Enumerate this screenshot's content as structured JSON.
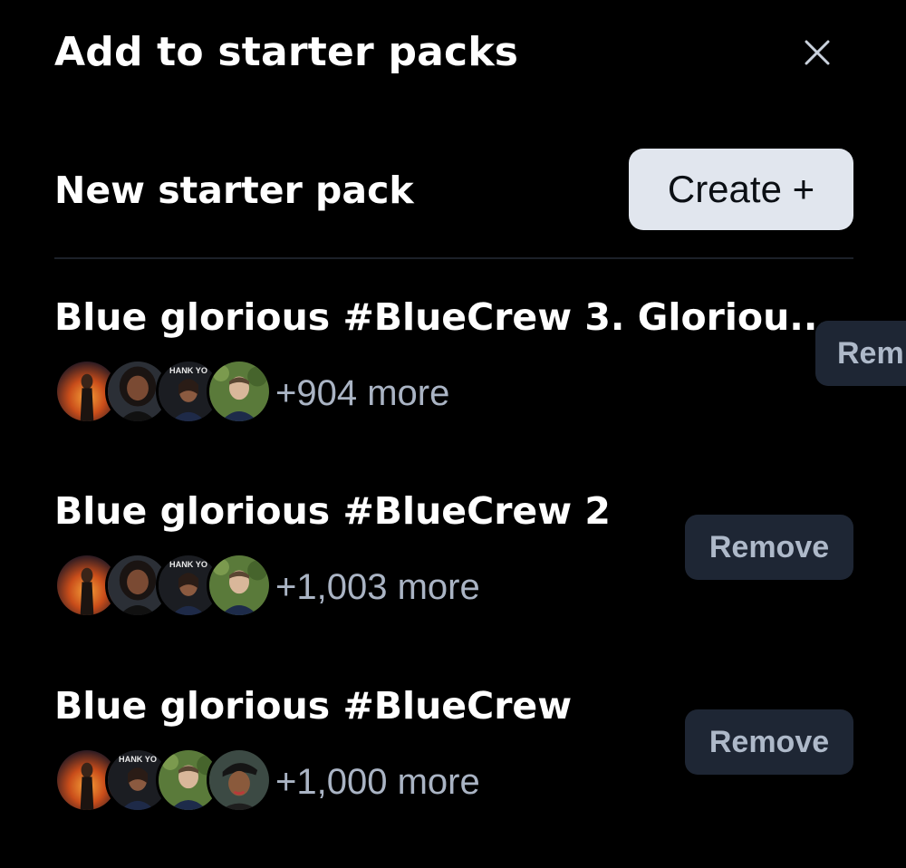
{
  "dialog": {
    "title": "Add to starter packs",
    "close_icon": "close-icon"
  },
  "new_pack": {
    "label": "New starter pack",
    "create_label": "Create +"
  },
  "packs": [
    {
      "name": "Blue glorious #BlueCrew 3. Gloriou...",
      "more": "+904 more",
      "remove_label": "Rem",
      "avatars": [
        "avatar-fire-figure",
        "avatar-woman-smiling",
        "avatar-thank-you-speaker",
        "avatar-man-outdoors"
      ]
    },
    {
      "name": "Blue glorious #BlueCrew 2",
      "more": "+1,003 more",
      "remove_label": "Remove",
      "avatars": [
        "avatar-fire-figure",
        "avatar-woman-smiling",
        "avatar-thank-you-speaker",
        "avatar-man-outdoors"
      ]
    },
    {
      "name": "Blue glorious #BlueCrew",
      "more": "+1,000 more",
      "remove_label": "Remove",
      "avatars": [
        "avatar-fire-figure",
        "avatar-thank-you-speaker",
        "avatar-man-outdoors",
        "avatar-woman-cap"
      ]
    }
  ],
  "avatar_text": {
    "thank_you": "HANK YO"
  },
  "colors": {
    "background": "#000000",
    "create_button": "#e1e6ee",
    "remove_button": "#1e2634",
    "muted_text": "#aab4c4"
  }
}
